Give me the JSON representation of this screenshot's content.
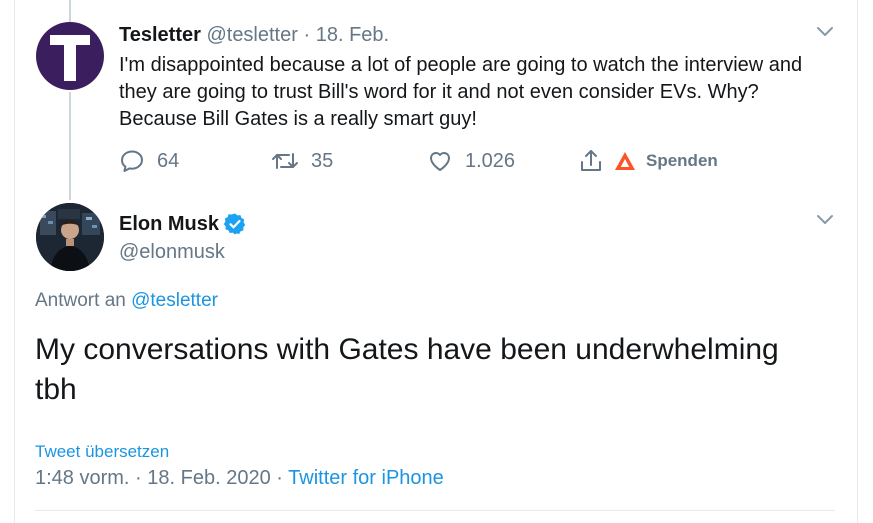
{
  "first_tweet": {
    "display_name": "Tesletter",
    "handle": "@tesletter",
    "separator": "·",
    "date": "18. Feb.",
    "avatar_letter": "T",
    "text": "I'm disappointed because a lot of people are going to watch the interview and they are going to trust Bill's word for it and not even consider EVs. Why? Because Bill Gates is a really smart guy!",
    "actions": {
      "reply_count": "64",
      "retweet_count": "35",
      "like_count": "1.026",
      "tip_label": "Spenden"
    }
  },
  "second_tweet": {
    "display_name": "Elon Musk",
    "handle": "@elonmusk",
    "reply_prefix": "Antwort an",
    "reply_handle": "@tesletter",
    "text": "My conversations with Gates have been underwhelming tbh",
    "translate_label": "Tweet übersetzen",
    "time": "1:48 vorm.",
    "date": "18. Feb. 2020",
    "separator": "·",
    "source": "Twitter for iPhone"
  },
  "colors": {
    "link": "#1b95e0",
    "muted": "#657786",
    "text": "#14171a",
    "verified": "#1da1f2",
    "brave": "#fb542b",
    "avatar_bg": "#3b1e5e"
  },
  "icons": {
    "reply": "reply-icon",
    "retweet": "retweet-icon",
    "like": "heart-icon",
    "share": "share-icon",
    "tip": "brave-triangle-icon",
    "menu": "chevron-down-icon",
    "verified": "verified-badge-icon"
  }
}
